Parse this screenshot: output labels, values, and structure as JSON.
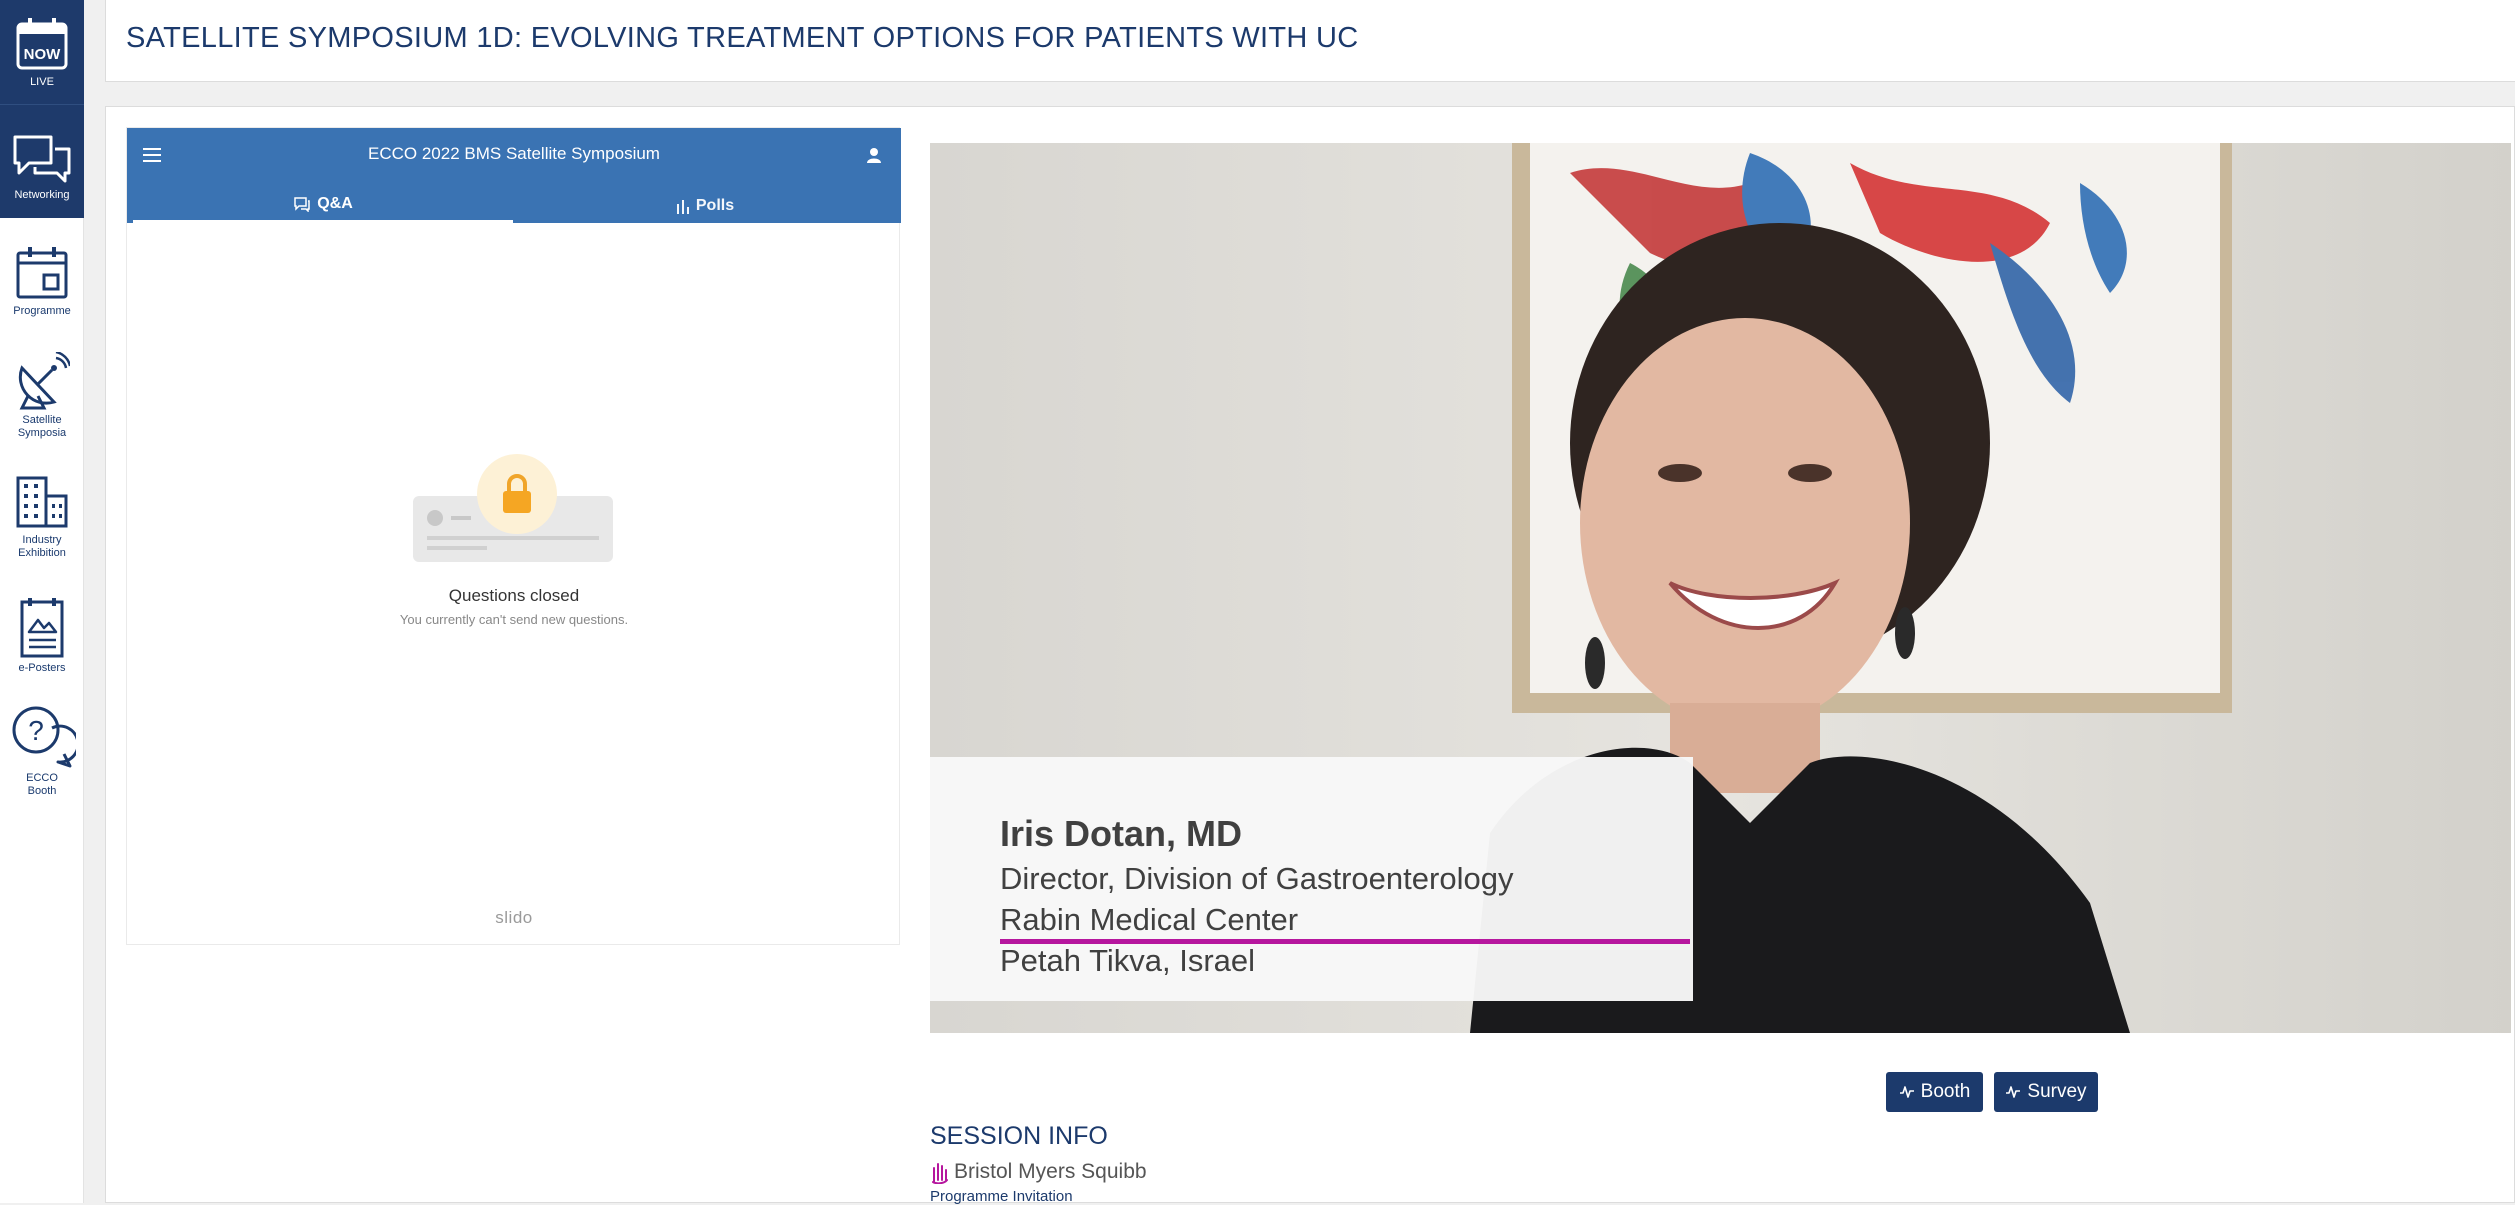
{
  "sidebar": {
    "items": [
      {
        "label": "LIVE",
        "badge": "NOW",
        "icon": "calendar-now-icon"
      },
      {
        "label": "Networking",
        "icon": "chat-bubbles-icon"
      },
      {
        "label": "Programme",
        "icon": "calendar-icon"
      },
      {
        "label": "Satellite\nSymposia",
        "icon": "satellite-dish-icon"
      },
      {
        "label": "Industry\nExhibition",
        "icon": "buildings-icon"
      },
      {
        "label": "e-Posters",
        "icon": "poster-icon"
      },
      {
        "label": "ECCO\nBooth",
        "icon": "help-bubbles-icon"
      }
    ]
  },
  "header": {
    "title": "SATELLITE SYMPOSIUM 1D: EVOLVING TREATMENT OPTIONS FOR PATIENTS WITH UC"
  },
  "slido": {
    "title": "ECCO 2022 BMS Satellite Symposium",
    "tabs": [
      {
        "label": "Q&A",
        "active": true
      },
      {
        "label": "Polls",
        "active": false
      }
    ],
    "empty_title": "Questions closed",
    "empty_subtitle": "You currently can't send new questions.",
    "brand": "slido"
  },
  "video": {
    "speaker_name": "Iris Dotan, MD",
    "speaker_role": "Director, Division of Gastroenterology",
    "speaker_org": "Rabin Medical Center",
    "speaker_location": "Petah Tikva, Israel"
  },
  "actions": {
    "booth": "Booth",
    "survey": "Survey"
  },
  "session": {
    "heading": "SESSION INFO",
    "sponsor": "Bristol Myers Squibb",
    "invitation": "Programme Invitation"
  },
  "colors": {
    "navy": "#1c3a6c",
    "slido_blue": "#3a73b3",
    "accent_magenta": "#b6169e"
  }
}
